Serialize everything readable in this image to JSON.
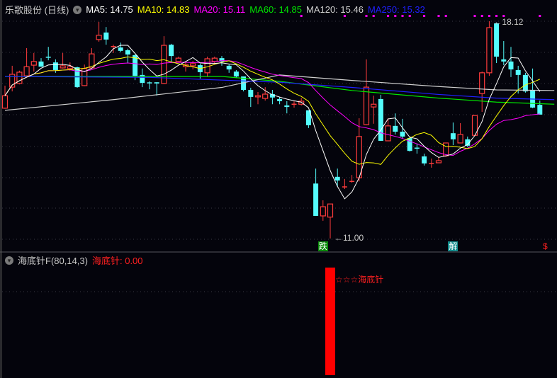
{
  "header": {
    "stock_title": "乐歌股份 (日线)",
    "ma_legend": [
      {
        "label": "MA5: 14.75",
        "color": "#ffffff"
      },
      {
        "label": "MA10: 14.83",
        "color": "#ffff00"
      },
      {
        "label": "MA20: 15.11",
        "color": "#ff00ff"
      },
      {
        "label": "MA60: 14.85",
        "color": "#00e600"
      },
      {
        "label": "MA120: 15.46",
        "color": "#d0d0d0"
      },
      {
        "label": "MA250: 15.32",
        "color": "#2020ff"
      }
    ]
  },
  "indicator": {
    "title": "海底针F(80,14,3)",
    "value_label": "海底针: 0.00",
    "signal_text": "☆☆☆海底针",
    "signal_index": 45,
    "signal_value": 1
  },
  "annotations": {
    "high_label": "18.12",
    "low_label": "11.00",
    "markers": [
      {
        "text": "跌",
        "index": 44,
        "bg": "#0a8a0a",
        "color": "#ffffff"
      },
      {
        "text": "解",
        "index": 62,
        "bg": "#128c8c",
        "color": "#ffffff"
      },
      {
        "text": "$",
        "index": 75,
        "bg": "transparent",
        "color": "#ff2020"
      }
    ]
  },
  "chart_data": {
    "type": "candlestick",
    "ylim": [
      10.85,
      18.12
    ],
    "colors": {
      "up": "#ff3c3c",
      "down": "#54fcfc",
      "grid": "#3a3a44",
      "dots": "#ff00ff"
    },
    "candles_ohlc": [
      [
        15.27,
        16.01,
        15.25,
        15.68
      ],
      [
        15.96,
        16.66,
        15.82,
        16.38
      ],
      [
        16.08,
        16.5,
        16.05,
        16.45
      ],
      [
        16.33,
        17.24,
        16.31,
        16.63
      ],
      [
        16.68,
        17.08,
        16.47,
        16.8
      ],
      [
        16.8,
        16.91,
        16.63,
        16.63
      ],
      [
        16.94,
        17.28,
        16.84,
        16.92
      ],
      [
        16.77,
        16.87,
        16.43,
        16.52
      ],
      [
        16.59,
        17.08,
        16.57,
        16.66
      ],
      [
        16.57,
        16.77,
        16.5,
        16.63
      ],
      [
        16.61,
        16.63,
        15.94,
        15.96
      ],
      [
        16.01,
        16.7,
        15.99,
        16.57
      ],
      [
        16.59,
        17.24,
        16.57,
        17.05
      ],
      [
        17.52,
        18.1,
        17.45,
        17.66
      ],
      [
        17.75,
        17.93,
        17.35,
        17.52
      ],
      [
        17.26,
        17.35,
        17.08,
        17.29
      ],
      [
        17.26,
        17.42,
        17.1,
        17.15
      ],
      [
        17.17,
        17.22,
        16.75,
        17.03
      ],
      [
        17.01,
        17.03,
        16.19,
        16.33
      ],
      [
        16.36,
        16.57,
        15.96,
        16.1
      ],
      [
        16.1,
        16.15,
        15.89,
        16.08
      ],
      [
        16.12,
        16.12,
        15.68,
        16.08
      ],
      [
        16.08,
        17.63,
        16.06,
        17.33
      ],
      [
        17.35,
        17.38,
        16.8,
        16.98
      ],
      [
        16.8,
        16.96,
        16.77,
        16.91
      ],
      [
        16.63,
        16.8,
        16.47,
        16.7
      ],
      [
        16.66,
        16.82,
        16.54,
        16.73
      ],
      [
        16.68,
        16.73,
        16.24,
        16.45
      ],
      [
        16.43,
        16.96,
        16.29,
        16.89
      ],
      [
        16.8,
        16.96,
        16.7,
        16.91
      ],
      [
        16.91,
        16.98,
        16.66,
        16.8
      ],
      [
        16.66,
        16.7,
        16.43,
        16.54
      ],
      [
        16.47,
        16.52,
        16.26,
        16.31
      ],
      [
        16.31,
        16.31,
        15.82,
        15.87
      ],
      [
        15.87,
        15.94,
        15.31,
        15.64
      ],
      [
        15.64,
        15.8,
        15.4,
        15.68
      ],
      [
        15.59,
        15.96,
        15.52,
        15.73
      ],
      [
        15.73,
        15.87,
        15.4,
        15.62
      ],
      [
        15.57,
        15.64,
        15.4,
        15.5
      ],
      [
        15.36,
        15.5,
        15.1,
        15.31
      ],
      [
        15.38,
        15.5,
        15.29,
        15.4
      ],
      [
        15.4,
        15.61,
        15.36,
        15.5
      ],
      [
        15.2,
        15.2,
        14.62,
        14.71
      ],
      [
        12.8,
        13.29,
        11.74,
        11.74
      ],
      [
        11.74,
        12.25,
        11.58,
        12.04
      ],
      [
        11.7,
        12.13,
        11.0,
        12.13
      ],
      [
        13.02,
        13.29,
        12.71,
        12.9
      ],
      [
        12.67,
        12.95,
        12.62,
        12.69
      ],
      [
        12.85,
        13.08,
        12.83,
        12.87
      ],
      [
        12.99,
        14.94,
        12.87,
        14.34
      ],
      [
        14.73,
        16.87,
        14.71,
        15.96
      ],
      [
        15.31,
        15.68,
        14.76,
        15.4
      ],
      [
        15.57,
        15.71,
        14.2,
        14.2
      ],
      [
        14.2,
        14.94,
        14.2,
        14.69
      ],
      [
        14.69,
        15.1,
        14.41,
        14.5
      ],
      [
        14.5,
        14.92,
        14.29,
        14.34
      ],
      [
        14.29,
        14.34,
        13.85,
        13.87
      ],
      [
        13.96,
        14.11,
        13.78,
        13.94
      ],
      [
        13.69,
        13.78,
        13.39,
        13.46
      ],
      [
        13.46,
        13.62,
        13.32,
        13.46
      ],
      [
        13.48,
        13.67,
        13.48,
        13.55
      ],
      [
        13.71,
        14.13,
        13.67,
        14.13
      ],
      [
        14.45,
        14.8,
        14.06,
        14.25
      ],
      [
        14.13,
        14.78,
        14.13,
        14.41
      ],
      [
        14.25,
        14.34,
        13.99,
        14.04
      ],
      [
        14.38,
        15.03,
        14.36,
        15.03
      ],
      [
        15.75,
        16.47,
        15.15,
        16.43
      ],
      [
        16.43,
        18.12,
        16.33,
        17.91
      ],
      [
        18.05,
        18.08,
        16.75,
        16.96
      ],
      [
        16.87,
        17.47,
        16.68,
        16.8
      ],
      [
        16.8,
        17.28,
        16.29,
        16.54
      ],
      [
        16.52,
        16.66,
        15.75,
        16.36
      ],
      [
        16.36,
        16.43,
        15.78,
        15.82
      ],
      [
        15.85,
        16.57,
        15.27,
        15.29
      ],
      [
        15.38,
        15.52,
        15.06,
        15.06
      ]
    ],
    "ma_long": {
      "MA60": [
        [
          0,
          16.31
        ],
        [
          30,
          16.31
        ],
        [
          38,
          16.15
        ],
        [
          48,
          15.85
        ],
        [
          60,
          15.6
        ],
        [
          68,
          15.47
        ],
        [
          76,
          15.4
        ]
      ],
      "MA120": [
        [
          0,
          15.2
        ],
        [
          15,
          15.55
        ],
        [
          30,
          15.95
        ],
        [
          38,
          16.36
        ],
        [
          48,
          16.18
        ],
        [
          60,
          15.98
        ],
        [
          68,
          15.87
        ],
        [
          76,
          15.85
        ]
      ],
      "MA250": [
        [
          0,
          16.31
        ],
        [
          20,
          16.28
        ],
        [
          38,
          16.12
        ],
        [
          48,
          15.95
        ],
        [
          60,
          15.72
        ],
        [
          68,
          15.6
        ],
        [
          76,
          15.55
        ]
      ]
    },
    "signal_dot_indices": [
      41,
      47,
      50,
      51,
      53,
      54,
      55,
      56,
      58,
      60,
      61,
      65,
      66,
      67,
      68,
      69,
      74
    ]
  }
}
